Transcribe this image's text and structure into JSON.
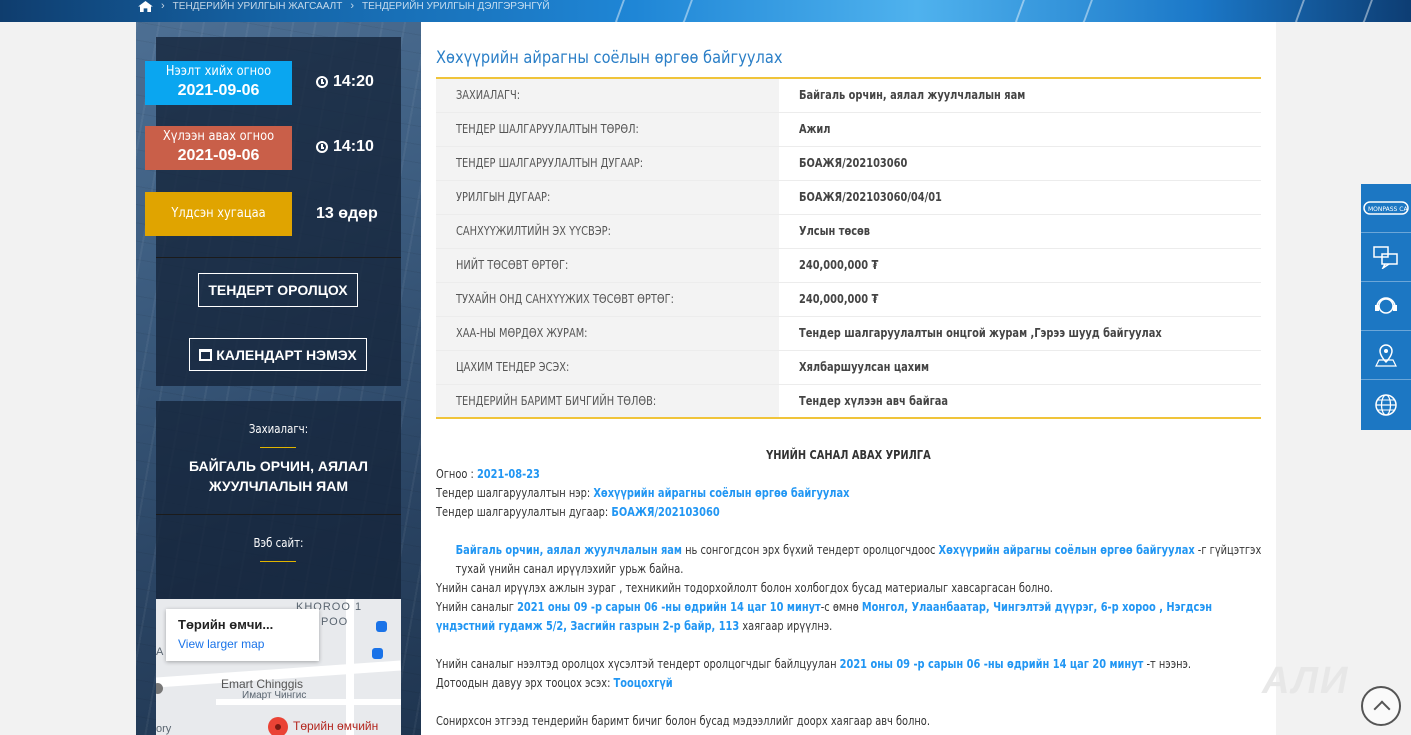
{
  "breadcrumb": {
    "items": [
      "ТЕНДЕРИЙН УРИЛГЫН ЖАГСААЛТ",
      "ТЕНДЕРИЙН УРИЛГЫН ДЭЛГЭРЭНГҮЙ"
    ]
  },
  "sidebar": {
    "open_date": {
      "label": "Нээлт хийх огноо",
      "date": "2021-09-06",
      "time": "14:20",
      "color": "#0aa6f0"
    },
    "receive_date": {
      "label": "Хүлээн авах огноо",
      "date": "2021-09-06",
      "time": "14:10",
      "color": "#c95f49"
    },
    "remaining": {
      "label": "Үлдсэн хугацаа",
      "value": "13 өдөр",
      "color": "#e0a400"
    },
    "participate_button": "ТЕНДЕРТ ОРОЛЦОХ",
    "calendar_button": "КАЛЕНДАРТ НЭМЭХ",
    "client_label": "Захиалагч:",
    "client_name": "БАЙГАЛЬ ОРЧИН, АЯЛАЛ ЖУУЛЧЛАЛЫН ЯАМ",
    "website_label": "Вэб сайт:"
  },
  "map": {
    "card_title": "Төрийн өмчи...",
    "card_link": "View larger map",
    "label_khoroo": "KHOROO 1",
    "label_roo": "РОО",
    "label_a": "А",
    "label_emart": "Emart Chinggis",
    "label_emart_mn": "Имарт Чингис",
    "label_pin": "Төрийн өмчийн",
    "label_ory": "ory"
  },
  "content": {
    "title": "Хөхүүрийн айрагны соёлын өргөө байгуулах",
    "rows": [
      {
        "key": "ЗАХИАЛАГЧ:",
        "value": "Байгаль орчин, аялал жуулчлалын яам"
      },
      {
        "key": "ТЕНДЕР ШАЛГАРУУЛАЛТЫН ТӨРӨЛ:",
        "value": "Ажил"
      },
      {
        "key": "ТЕНДЕР ШАЛГАРУУЛАЛТЫН ДУГААР:",
        "value": "БОАЖЯ/202103060"
      },
      {
        "key": "УРИЛГЫН ДУГААР:",
        "value": "БОАЖЯ/202103060/04/01"
      },
      {
        "key": "САНХҮҮЖИЛТИЙН ЭХ ҮҮСВЭР:",
        "value": "Улсын төсөв"
      },
      {
        "key": "НИЙТ ТӨСӨВТ ӨРТӨГ:",
        "value": "240,000,000 ₮"
      },
      {
        "key": "ТУХАЙН ОНД САНХҮҮЖИХ ТӨСӨВТ ӨРТӨГ:",
        "value": "240,000,000 ₮"
      },
      {
        "key": "ХАА-НЫ МӨРДӨХ ЖУРАМ:",
        "value": "Тендер шалгаруулалтын онцгой журам ,Гэрээ шууд байгуулах"
      },
      {
        "key": "ЦАХИМ ТЕНДЕР ЭСЭХ:",
        "value": "Хялбаршуулсан цахим"
      },
      {
        "key": "ТЕНДЕРИЙН БАРИМТ БИЧГИЙН ТӨЛӨВ:",
        "value": "Тендер хүлээн авч байгаа"
      }
    ]
  },
  "notice": {
    "title": "ҮНИЙН САНАЛ АВАХ УРИЛГА",
    "date_label": "Огноо : ",
    "date_value": "2021-08-23",
    "name_label": "Тендер шалгаруулалтын нэр: ",
    "name_value": "Хөхүүрийн айрагны соёлын өргөө байгуулах",
    "number_label": "Тендер шалгаруулалтын дугаар: ",
    "number_value": "БОАЖЯ/202103060",
    "para_org": "Байгаль орчин, аялал жуулчлалын яам",
    "para_mid": " нь сонгогдсон эрх бүхий тендерт оролцогчдоос ",
    "para_project": "Хөхүүрийн айрагны соёлын өргөө байгуулах",
    "para_end": " -г гүйцэтгэх тухай үнийн санал ирүүлэхийг урьж байна.",
    "line_materials": "Үнийн санал ирүүлэх ажлын зураг , техникийн тодорхойлолт болон холбогдох бусад материалыг хавсаргасан болно.",
    "submit_prefix": "Үнийн саналыг ",
    "submit_time": "2021 оны 09 -р сарын 06 -ны өдрийн 14 цаг 10 минут",
    "submit_mid": "-с өмнө ",
    "submit_address": "Монгол, Улаанбаатар, Чингэлтэй дүүрэг, 6-р хороо , Нэгдсэн үндэстний гудамж 5/2, Засгийн газрын 2-р байр, 113",
    "submit_end": " хаягаар ирүүлнэ.",
    "open_prefix": "Үнийн саналыг нээлтэд оролцох хүсэлтэй тендерт оролцогчдыг байлцуулан ",
    "open_time": "2021 оны 09 -р сарын 06 -ны өдрийн 14 цаг 20 минут",
    "open_end": " -т нээнэ.",
    "pref_label": "Дотоодын давуу эрх тооцох эсэх: ",
    "pref_value": "Тооцохгүй",
    "last_line": "Сонирхсон этгээд тендерийн баримт бичиг болон бусад мэдээллийг доорх хаягаар авч болно."
  },
  "float_bar": {
    "items": [
      "monpass-ca-icon",
      "chat-icon",
      "support-icon",
      "location-icon",
      "globe-icon"
    ],
    "monpass_label": "MONPASS CA"
  },
  "watermark": "АЛИ"
}
